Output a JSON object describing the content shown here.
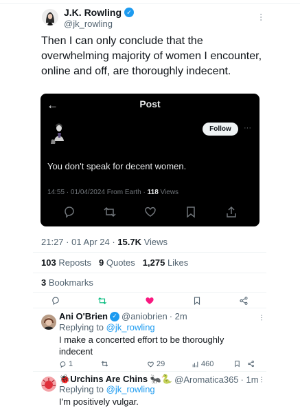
{
  "tweet": {
    "author_name": "J.K. Rowling",
    "author_handle": "@jk_rowling",
    "text": "Then I can only conclude that the overwhelming majority of women I encounter, online and off, are thoroughly indecent.",
    "time": "21:27 · 01 Apr 24 · ",
    "views_count": "15.7K",
    "views_label": " Views",
    "reposts_count": "103",
    "reposts_label": " Reposts",
    "quotes_count": "9",
    "quotes_label": " Quotes",
    "likes_count": "1,275",
    "likes_label": " Likes",
    "bookmarks_count": "3",
    "bookmarks_label": " Bookmarks"
  },
  "embed": {
    "title": "Post",
    "back_icon": "←",
    "follow_label": "Follow",
    "more": "···",
    "text": "You don't speak for decent women.",
    "meta": "14:55 · 01/04/2024 From Earth · ",
    "views_count": "118",
    "views_label": " Views"
  },
  "replies": [
    {
      "name": "Ani O'Brien",
      "handle": "@aniobrien",
      "time": "· 2m",
      "replying_prefix": "Replying to ",
      "replying_to": "@jk_rowling",
      "text": "I make a concerted effort to be thoroughly indecent",
      "reply_count": "1",
      "like_count": "29",
      "view_count": "460"
    },
    {
      "name_prefix": "🐞",
      "name": "Urchins Are Chins",
      "name_suffix": "🐜🐍",
      "handle": "@Aromatica365",
      "time": "· 1m",
      "replying_prefix": "Replying to ",
      "replying_to": "@jk_rowling",
      "text": "I'm positively vulgar."
    }
  ],
  "colors": {
    "accent": "#1d9bf0",
    "like_active": "#f91880",
    "repost_active": "#00ba7c",
    "muted": "#536471"
  }
}
